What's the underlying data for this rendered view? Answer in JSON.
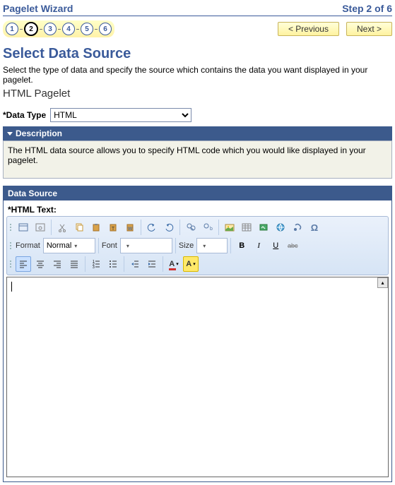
{
  "header": {
    "title": "Pagelet Wizard",
    "step_text": "Step 2 of 6"
  },
  "nav": {
    "prev": "< Previous",
    "next": "Next >"
  },
  "steps": [
    "1",
    "2",
    "3",
    "4",
    "5",
    "6"
  ],
  "active_step": 2,
  "section": {
    "title": "Select Data Source",
    "instruction": "Select the type of data and specify the source which contains the data you want displayed in your pagelet.",
    "pagelet_name": "HTML Pagelet"
  },
  "data_type": {
    "label": "*Data Type",
    "value": "HTML"
  },
  "description": {
    "header": "Description",
    "text": "The HTML data source allows you to specify HTML code which you would like displayed in your pagelet."
  },
  "data_source": {
    "header": "Data Source",
    "html_label": "*HTML Text:",
    "format_label": "Format",
    "format_value": "Normal",
    "font_label": "Font",
    "font_value": "",
    "size_label": "Size",
    "size_value": "",
    "bold": "B",
    "italic": "I",
    "underline": "U",
    "strike": "abc"
  }
}
